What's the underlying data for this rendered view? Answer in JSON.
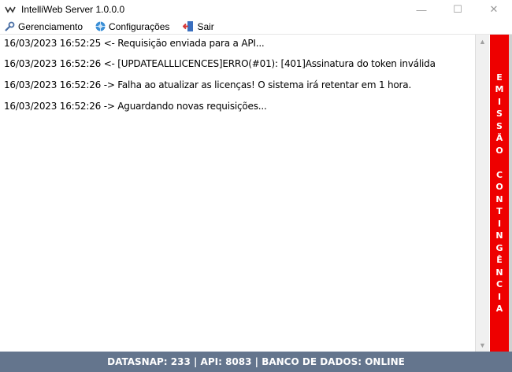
{
  "window": {
    "title": "IntelliWeb Server 1.0.0.0",
    "controls": {
      "minimize": "—",
      "maximize": "☐",
      "close": "✕"
    }
  },
  "menu": {
    "items": [
      {
        "label": "Gerenciamento",
        "icon": "wrench-icon"
      },
      {
        "label": "Configurações",
        "icon": "gear-globe-icon"
      },
      {
        "label": "Sair",
        "icon": "exit-door-icon"
      }
    ]
  },
  "log": {
    "lines": [
      "16/03/2023 16:52:25 <- Requisição enviada para a API...",
      "16/03/2023 16:52:26 <- [UPDATEALLLICENCES]ERRO(#01): [401]Assinatura do token inválida",
      "16/03/2023 16:52:26 -> Falha ao atualizar as licenças! O sistema irá retentar em 1 hora.",
      "16/03/2023 16:52:26 -> Aguardando novas requisições..."
    ]
  },
  "banner": {
    "word1": [
      "E",
      "M",
      "I",
      "S",
      "S",
      "Ã",
      "O"
    ],
    "word2": [
      "C",
      "O",
      "N",
      "T",
      "I",
      "N",
      "G",
      "Ê",
      "N",
      "C",
      "I",
      "A"
    ],
    "color": "#ee0000"
  },
  "status": {
    "text": "DATASNAP: 233 | API: 8083 | BANCO DE DADOS: ONLINE",
    "color": "#64758d"
  }
}
